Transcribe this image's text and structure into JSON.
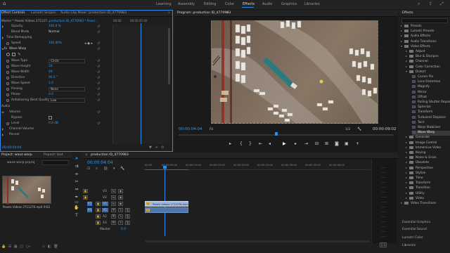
{
  "app": {
    "workspaces": [
      "Learning",
      "Assembly",
      "Editing",
      "Color",
      "Effects",
      "Audio",
      "Graphics",
      "Libraries"
    ],
    "active_workspace": "Effects"
  },
  "effect_controls": {
    "tabs": [
      "Effect Controls",
      "Lumetri Scopes",
      "Audio Clip Mixer: production ID_4770983"
    ],
    "breadcrumb": "Master * Pexels Videos 271127...",
    "clip_ref": "production ID_4770983 * Pexel...",
    "timecode_left": "00:00",
    "timecode_right": "00:00:05:00",
    "rows": [
      {
        "label": "Opacity",
        "value": "100.0 %"
      },
      {
        "label": "Blend Mode",
        "value": "Normal"
      },
      {
        "label": "Time Remapping",
        "value": ""
      },
      {
        "label": "Speed",
        "value": "100.00%"
      },
      {
        "label": "Wave Warp",
        "value": ""
      },
      {
        "label": "Wave Type",
        "value": "Circle"
      },
      {
        "label": "Wave Height",
        "value": "10"
      },
      {
        "label": "Wave Width",
        "value": "40"
      },
      {
        "label": "Direction",
        "value": "90.0 °"
      },
      {
        "label": "Wave Speed",
        "value": "1.0"
      },
      {
        "label": "Pinning",
        "value": "None"
      },
      {
        "label": "Phase",
        "value": "0.0"
      },
      {
        "label": "Antialiasing (Best Quality)",
        "value": "Low"
      },
      {
        "label": "Audio",
        "value": ""
      },
      {
        "label": "Volume",
        "value": ""
      },
      {
        "label": "Bypass",
        "value": ""
      },
      {
        "label": "Level",
        "value": "0.0 dB"
      },
      {
        "label": "Channel Volume",
        "value": ""
      },
      {
        "label": "Panner",
        "value": ""
      }
    ],
    "footer_timecode": "00:00:04:04"
  },
  "program": {
    "title": "Program: production ID_4770983",
    "timecode": "00:00:04:04",
    "fit": "Fit",
    "quality": "1/2",
    "duration": "00:00:09:02"
  },
  "effects_panel": {
    "title": "Effects",
    "tree": [
      {
        "label": "Presets",
        "type": "folder"
      },
      {
        "label": "Lumetri Presets",
        "type": "folder"
      },
      {
        "label": "Audio Effects",
        "type": "folder"
      },
      {
        "label": "Audio Transitions",
        "type": "folder"
      },
      {
        "label": "Video Effects",
        "type": "folder-open"
      },
      {
        "label": "Adjust",
        "type": "sub"
      },
      {
        "label": "Blur & Sharpen",
        "type": "sub"
      },
      {
        "label": "Channel",
        "type": "sub"
      },
      {
        "label": "Color Correction",
        "type": "sub"
      },
      {
        "label": "Distort",
        "type": "sub-open"
      },
      {
        "label": "Corner Pin",
        "type": "fx"
      },
      {
        "label": "Lens Distortion",
        "type": "fx"
      },
      {
        "label": "Magnify",
        "type": "fx"
      },
      {
        "label": "Mirror",
        "type": "fx"
      },
      {
        "label": "Offset",
        "type": "fx"
      },
      {
        "label": "Rolling Shutter Repair",
        "type": "fx"
      },
      {
        "label": "Spherize",
        "type": "fx"
      },
      {
        "label": "Transform",
        "type": "fx"
      },
      {
        "label": "Turbulent Displace",
        "type": "fx"
      },
      {
        "label": "Twirl",
        "type": "fx"
      },
      {
        "label": "Warp Stabilizer",
        "type": "fx"
      },
      {
        "label": "Wave Warp",
        "type": "fx-sel"
      },
      {
        "label": "Generate",
        "type": "sub"
      },
      {
        "label": "Image Control",
        "type": "sub"
      },
      {
        "label": "Immersive Video",
        "type": "sub"
      },
      {
        "label": "Keying",
        "type": "sub"
      },
      {
        "label": "Noise & Grain",
        "type": "sub"
      },
      {
        "label": "Obsolete",
        "type": "sub"
      },
      {
        "label": "Perspective",
        "type": "sub"
      },
      {
        "label": "Stylize",
        "type": "sub"
      },
      {
        "label": "Time",
        "type": "sub"
      },
      {
        "label": "Transform",
        "type": "sub"
      },
      {
        "label": "Transition",
        "type": "sub"
      },
      {
        "label": "Utility",
        "type": "sub"
      },
      {
        "label": "Video",
        "type": "sub"
      },
      {
        "label": "Video Transitions",
        "type": "folder"
      }
    ],
    "bottom": [
      "Essential Graphics",
      "Essential Sound",
      "Lumetri Color",
      "Libraries"
    ]
  },
  "project": {
    "tabs": [
      "Project: wave warp",
      "Project: text"
    ],
    "file": "wave warp.prproj",
    "clip_name": "Pexels Videos 2711276.mp4",
    "clip_duration": "9:02"
  },
  "timeline": {
    "tab": "production ID_4770983",
    "timecode": "00:00:04:04",
    "ruler": [
      "00:00",
      "00:00:05:00",
      "00:00:10:00",
      "00:00:15:00",
      "00:00:20:00",
      "00:00:25:00",
      "00:00:30:00",
      "00:00:35:00",
      "00:00:40:00"
    ],
    "tracks": [
      "V3",
      "V2",
      "V1",
      "A1",
      "A2",
      "A3",
      "Master"
    ],
    "master_value": "0.0",
    "clip_label": "Pexels Videos 2711276.mp4 [V]"
  },
  "colors": {
    "accent": "#2d8ceb",
    "timecode": "#2f9cf5",
    "clip_video": "#9fb7de",
    "clip_audio": "#4f78ad"
  }
}
